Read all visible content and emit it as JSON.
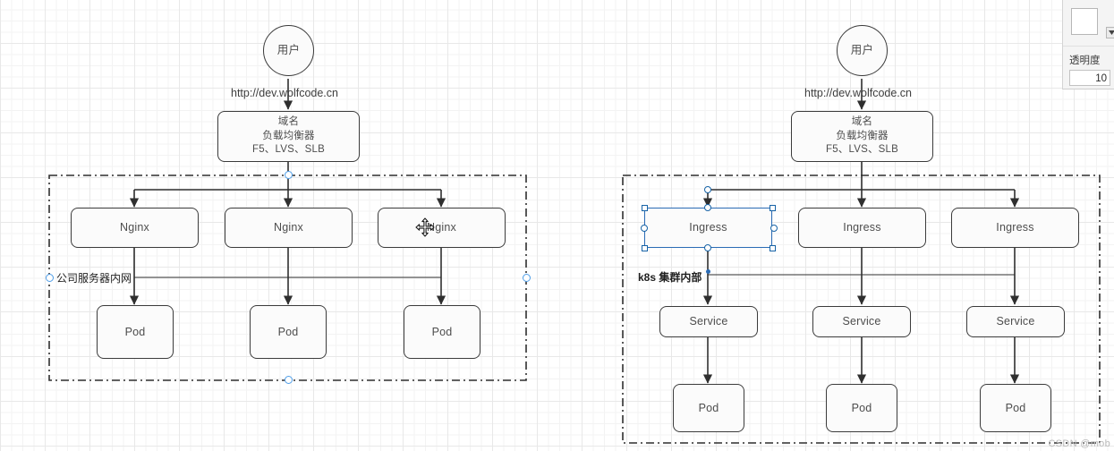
{
  "app": {
    "watermark": "CSDN @mob"
  },
  "panel": {
    "color_swatch_name": "fill-color-swatch",
    "opacity_label": "透明度",
    "opacity_value": "10",
    "accent": "#1763a6"
  },
  "diagrams": {
    "left": {
      "actor": "用户",
      "url_label": "http://dev.wolfcode.cn",
      "lb": {
        "line1": "域名",
        "line2": "负载均衡器",
        "line3": "F5、LVS、SLB"
      },
      "container_label": "公司服务器内网",
      "tier1": [
        "Nginx",
        "Nginx",
        "Nginx"
      ],
      "tier2": [
        "Pod",
        "Pod",
        "Pod"
      ]
    },
    "right": {
      "actor": "用户",
      "url_label": "http://dev.wolfcode.cn",
      "lb": {
        "line1": "域名",
        "line2": "负载均衡器",
        "line3": "F5、LVS、SLB"
      },
      "container_label": "k8s 集群内部",
      "tier1": [
        "Ingress",
        "Ingress",
        "Ingress"
      ],
      "tier2": [
        "Service",
        "Service",
        "Service"
      ],
      "tier3": [
        "Pod",
        "Pod",
        "Pod"
      ]
    }
  }
}
